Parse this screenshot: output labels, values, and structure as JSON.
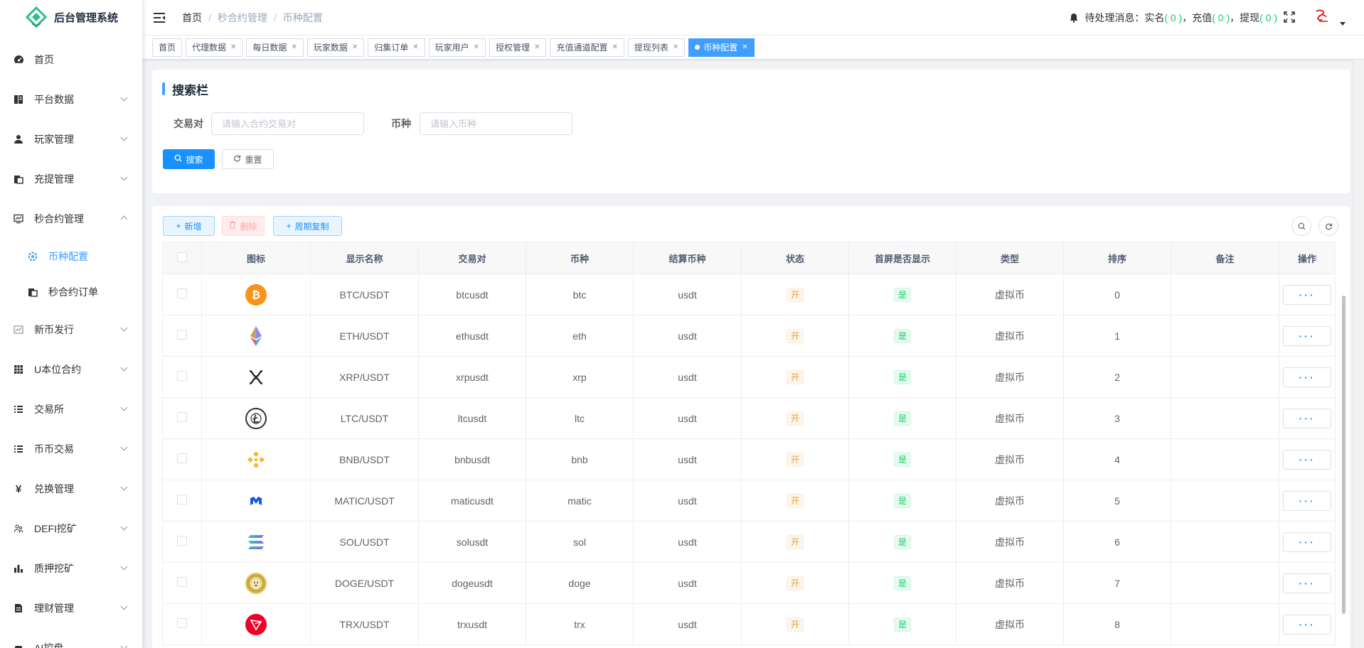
{
  "app": {
    "title": "后台管理系统",
    "brand_color": "#2dbd8c",
    "accent": "#409eff"
  },
  "sidebar": {
    "items": [
      {
        "label": "首页",
        "icon": "dashboard-icon"
      },
      {
        "label": "平台数据",
        "icon": "book-icon"
      },
      {
        "label": "玩家管理",
        "icon": "user-icon"
      },
      {
        "label": "充提管理",
        "icon": "clipboard-icon"
      },
      {
        "label": "秒合约管理",
        "icon": "monitor-icon"
      },
      {
        "label": "新币发行",
        "icon": "chart-icon"
      },
      {
        "label": "U本位合约",
        "icon": "grid-icon"
      },
      {
        "label": "交易所",
        "icon": "list-icon"
      },
      {
        "label": "币币交易",
        "icon": "list-icon"
      },
      {
        "label": "兑换管理",
        "icon": "yen-icon"
      },
      {
        "label": "DEFI挖矿",
        "icon": "people-icon"
      },
      {
        "label": "质押挖矿",
        "icon": "bar-chart-icon"
      },
      {
        "label": "理财管理",
        "icon": "document-icon"
      },
      {
        "label": "AI控盘",
        "icon": "robot-icon"
      }
    ],
    "sub_items": [
      {
        "label": "币种配置",
        "icon": "settings-icon"
      },
      {
        "label": "秒合约订单",
        "icon": "clipboard-icon"
      }
    ]
  },
  "header": {
    "breadcrumb": [
      "首页",
      "秒合约管理",
      "币种配置"
    ],
    "notice_prefix": "待处理消息：实名",
    "notice_realname_count": "( 0 )",
    "notice_recharge_label": "，充值",
    "notice_recharge_count": "( 0 )",
    "notice_withdraw_label": "，提现",
    "notice_withdraw_count": "( 0 )"
  },
  "tags": [
    "首页",
    "代理数据",
    "每日数据",
    "玩家数据",
    "归集订单",
    "玩家用户",
    "授权管理",
    "充值通道配置",
    "提现列表",
    "币种配置"
  ],
  "search": {
    "title": "搜索栏",
    "pair_label": "交易对",
    "pair_placeholder": "请输入合约交易对",
    "coin_label": "币种",
    "coin_placeholder": "请输入币种",
    "search_btn": "搜索",
    "reset_btn": "重置"
  },
  "toolbar": {
    "add_btn": "新增",
    "delete_btn": "删除",
    "copy_btn": "周期复制"
  },
  "table": {
    "columns": [
      "图标",
      "显示名称",
      "交易对",
      "币种",
      "结算币种",
      "状态",
      "首屏是否显示",
      "类型",
      "排序",
      "备注",
      "操作"
    ],
    "rows": [
      {
        "name": "BTC/USDT",
        "pair": "btcusdt",
        "coin": "btc",
        "settle": "usdt",
        "status": "开",
        "home": "是",
        "type": "虚拟币",
        "sort": "0",
        "note": "",
        "icon": "btc-icon"
      },
      {
        "name": "ETH/USDT",
        "pair": "ethusdt",
        "coin": "eth",
        "settle": "usdt",
        "status": "开",
        "home": "是",
        "type": "虚拟币",
        "sort": "1",
        "note": "",
        "icon": "eth-icon"
      },
      {
        "name": "XRP/USDT",
        "pair": "xrpusdt",
        "coin": "xrp",
        "settle": "usdt",
        "status": "开",
        "home": "是",
        "type": "虚拟币",
        "sort": "2",
        "note": "",
        "icon": "xrp-icon"
      },
      {
        "name": "LTC/USDT",
        "pair": "ltcusdt",
        "coin": "ltc",
        "settle": "usdt",
        "status": "开",
        "home": "是",
        "type": "虚拟币",
        "sort": "3",
        "note": "",
        "icon": "ltc-icon"
      },
      {
        "name": "BNB/USDT",
        "pair": "bnbusdt",
        "coin": "bnb",
        "settle": "usdt",
        "status": "开",
        "home": "是",
        "type": "虚拟币",
        "sort": "4",
        "note": "",
        "icon": "bnb-icon"
      },
      {
        "name": "MATIC/USDT",
        "pair": "maticusdt",
        "coin": "matic",
        "settle": "usdt",
        "status": "开",
        "home": "是",
        "type": "虚拟币",
        "sort": "5",
        "note": "",
        "icon": "matic-icon"
      },
      {
        "name": "SOL/USDT",
        "pair": "solusdt",
        "coin": "sol",
        "settle": "usdt",
        "status": "开",
        "home": "是",
        "type": "虚拟币",
        "sort": "6",
        "note": "",
        "icon": "sol-icon"
      },
      {
        "name": "DOGE/USDT",
        "pair": "dogeusdt",
        "coin": "doge",
        "settle": "usdt",
        "status": "开",
        "home": "是",
        "type": "虚拟币",
        "sort": "7",
        "note": "",
        "icon": "doge-icon"
      },
      {
        "name": "TRX/USDT",
        "pair": "trxusdt",
        "coin": "trx",
        "settle": "usdt",
        "status": "开",
        "home": "是",
        "type": "虚拟币",
        "sort": "8",
        "note": "",
        "icon": "trx-icon"
      }
    ],
    "action_label": "···"
  }
}
